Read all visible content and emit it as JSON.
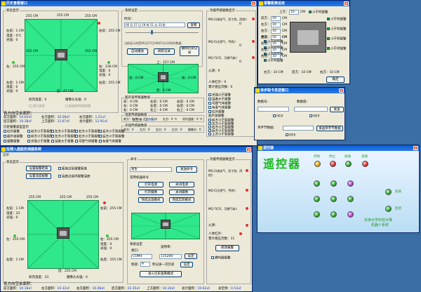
{
  "history_window": {
    "title": "历史查看窗口",
    "status_group": "状态显示",
    "map": {
      "top": "255 CM",
      "left_top": "左前：1 CM",
      "right_top": "右前：255 CM",
      "left": "左：255 CM",
      "right": "右：236 CM",
      "left_back": "左后：1 CM",
      "right_back": "右后：255 CM",
      "back": "后：47 CM",
      "side_left": "255 CM",
      "side_right": "255 CM",
      "mid_left": "255 CM",
      "mid_right": "255 CM",
      "temp": "温度：",
      "temp_v": "0℃",
      "light": "光强：",
      "light_v": "0",
      "temp2": "温度：",
      "temp2_v": "0",
      "light2": "光强：0",
      "temp3": "温度：",
      "temp3_v": "0",
      "light3": "光强：0",
      "body_temp": "机内温度：",
      "body_temp_v": "0",
      "cam_light": "摄像头光强：",
      "cam_light_v": "0",
      "ctrl_label": "操作模式：",
      "check_speed": "进行速度",
      "check_alarm": "超越障碍物报警"
    },
    "area_title": "各方向空余面积：",
    "area": {
      "front": "前方面积：",
      "front_v": "10.65㎡",
      "left": "左方面积：",
      "left_v": "10.58㎡",
      "right": "右方面积：",
      "right_v": "1.21㎡",
      "back": "后方面积：",
      "back_v": "10.38㎡",
      "up": "上方面积：",
      "up_v": "12.67㎡",
      "total": "总计面积：",
      "total_v": "12.91㎡",
      "free": "总空余：",
      "free_v": "3.76㎡"
    },
    "history_alarm": "历史报警类型显示",
    "alarms_row1": [
      "红外报警",
      "前方小于耐报警",
      "左方小于耐报警",
      "右方小于耐报警",
      "后方小于耐报警"
    ],
    "alarms_row2": [
      "超声波报警",
      "前方小于耐报警",
      "左方小于耐报警",
      "右方小于耐报警",
      "后方小于耐报警"
    ],
    "alarms_row3": [
      "烟雾报警",
      "光强小于报警",
      "温度大于报警",
      "可燃气体报警",
      "有毒气体报警"
    ],
    "sys_group": "系统设定",
    "time_label": "时间：",
    "time_value": "06 月 27 日 19 时 51 分 33 秒",
    "query_btn": "查看",
    "history_text": "当前显示的是06月27日19时51分33秒的数据",
    "btn_auto": "自动播放",
    "btn_refresh": "刷新记录",
    "btn_delete": "删除历史记录",
    "small_map": {
      "top": "上：227 CM",
      "right": "右：0 CM",
      "left": "左：0 CM",
      "back": "后：0 CM"
    },
    "dist_group": "超声波传感器数值",
    "dist_rows": [
      [
        "前：0 CM",
        "左前：0 CM",
        "右前：0 CM"
      ],
      [
        "左：0 CM",
        "左后：0 CM",
        "右后：0 CM"
      ],
      [
        "右：0 CM",
        "左上：0 CM",
        "右上：0 CM"
      ]
    ],
    "temp_group": "温度传感器数值",
    "temp_rows": [
      "前方：0 ℃",
      "左方：0 ℃",
      "右方：0 ℃",
      "机内温度：0 ℃"
    ],
    "light_group": "光强传感器数值",
    "light_rows": [
      "前方：0",
      "左方：0",
      "右方：0",
      "后方：0",
      "摄像头：0"
    ],
    "func_group": "功能传感器数显示",
    "func": {
      "mq2": "MQ-2(液化气、异丁烷、丙烷)：",
      "mq2_v": "0",
      "mq5": "MQ-5(天然气、甲烷)：",
      "mq5_v": "0",
      "mq7": "MQ-7(CO、可燃气体)：",
      "mq7_v": "0",
      "fire": "火源：",
      "fire_v": "0",
      "body": "人体红外：",
      "body_v": "0",
      "inter": "累计感应次数：",
      "inter_v": "0"
    },
    "func_checks": [
      "光强小于报警",
      "温度大于报警",
      "可燃气体报警",
      "有毒气体报警",
      "红外报警"
    ],
    "dist_alarm_group": "超声波报警",
    "dist_alarm_checks": [
      "前方小于耐报警",
      "左方小于耐报警",
      "右方小于耐报警",
      "后方小于耐报警",
      "上方小于耐报警"
    ]
  },
  "alarm_window": {
    "title": "报警距离设定",
    "rows": [
      {
        "label": "上方：",
        "value": "10",
        "unit": "CM",
        "check": "小于时报警"
      },
      {
        "label": "前方：",
        "value": "10",
        "unit": "CM",
        "check": "小于时报警"
      },
      {
        "label": "左方：",
        "value": "10",
        "unit": "CM",
        "check": "小于时报警"
      },
      {
        "label": "右方：",
        "value": "10",
        "unit": "CM",
        "check": "小于时报警"
      },
      {
        "label": "后方：",
        "value": "10",
        "unit": "CM",
        "check": "小于时报警"
      }
    ],
    "extra_rows": [
      {
        "label": "左前：",
        "value": "10",
        "unit": "CM",
        "check": "小于时报警"
      },
      {
        "label": "右前：",
        "value": "10",
        "unit": "CM",
        "check": "小于时报警"
      },
      {
        "label": "左后：",
        "value": "10",
        "unit": "CM",
        "check": "小于时报警"
      },
      {
        "label": "右后：",
        "value": "10",
        "unit": "CM",
        "check": "小于时报警"
      }
    ],
    "right_checks": [
      "小于时报警",
      "小于时报警",
      "小于时报警",
      "小于时报警"
    ],
    "bottom": {
      "left": "左方：10 CM",
      "right": "右方：10 CM",
      "back": "后方：10 CM"
    },
    "ok_btn": "确定"
  },
  "serial_window": {
    "title": "单步取卡发送窗口",
    "data_label": "数据号：",
    "data_label2": "数据值：",
    "send_btn": "发送",
    "hex1": "HEX",
    "hex2": "HEX",
    "step_label": "单字节数据：",
    "step_btn": "发送单字节数据",
    "hex3": "HEX"
  },
  "main_window": {
    "title": "检测入盘股扮演器系统",
    "menu": "菜单",
    "status_group": "状态显示",
    "btn_mode": "设置报警距离",
    "btn_hist": "设置温度报警",
    "check_a": "距离过近报警距离",
    "check_b": "温度过高时报警温度",
    "map": {
      "top": "255 CM",
      "left_top": "左前：1 CM",
      "right_top": "右前：255 CM",
      "left": "左：255 CM",
      "right": "右：255 CM",
      "left_back": "左后：1 CM",
      "right_back": "右后：255 CM",
      "back": "后：255 CM",
      "side_left": "255 CM",
      "side_right": "255 CM",
      "temp": "温度：",
      "temp_v": "33",
      "light": "光强：",
      "light_v": "0",
      "temp2": "温度：",
      "temp2_v": "0",
      "light2": "光强：0",
      "body_temp": "机内温度：",
      "body_temp_v": "33",
      "cam_light": "摄像头光强：",
      "cam_light_v": "0"
    },
    "area_title": "各方向空余面积：",
    "area": {
      "front": "前方面积：",
      "front_v": "10.18㎡",
      "left": "左方面积：",
      "left_v": "10.32㎡",
      "right": "右方面积：",
      "right_v": "10.08㎡",
      "back": "后方面积：",
      "back_v": "10.35㎡",
      "up": "上方面积：",
      "up_v": "10.10㎡",
      "total": "总计面积：",
      "total_v": "10.62㎡",
      "free": "总空余：",
      "free_v": "0.53㎡"
    },
    "cmd_group": "命令",
    "cmd_input": "发生",
    "send_btn": "发送命令",
    "common_group": "常用机器命令",
    "btns": [
      "打开电源",
      "关闭电源",
      "打开摄像",
      "关闭摄像",
      "完成过滤模式",
      "完成实际模式"
    ],
    "sys_group": "系统设定",
    "port_label": "端口：",
    "port_value": "COM4",
    "baud_label": "波特率：",
    "baud_value": "115200",
    "set_btn": "设定",
    "interval_label": "频道：",
    "interval_value": "9",
    "sec_label": "秒记录一次历史",
    "set_btn2": "设定",
    "enter_hist": "进入历史查看模式",
    "func_group": "功能传感器数显示",
    "func": {
      "mq2": "MQ-2(液化气、异丁烷、丙烷)：",
      "mq2_v": "",
      "mq5": "MQ-5(天然气、甲烷)：",
      "mq5_v": "",
      "mq7": "MQ-7(CO、可燃气体)：",
      "mq7_v": "",
      "fire": "火源：",
      "fire_v": "",
      "body": "人体红外：",
      "inter": "累计感应次数：",
      "inter_v": "11"
    },
    "modify_btn": "修改报警",
    "beep_check": "蜂鸣器报警"
  },
  "remote_window": {
    "title": "遥控器",
    "heading": "遥控器",
    "top_labels": [
      "开始",
      "停止",
      "加速",
      "减速"
    ],
    "side_labels": [
      "前进",
      "后退"
    ],
    "footer1": "东南大学科技大赛",
    "footer2": "机器人系统"
  }
}
